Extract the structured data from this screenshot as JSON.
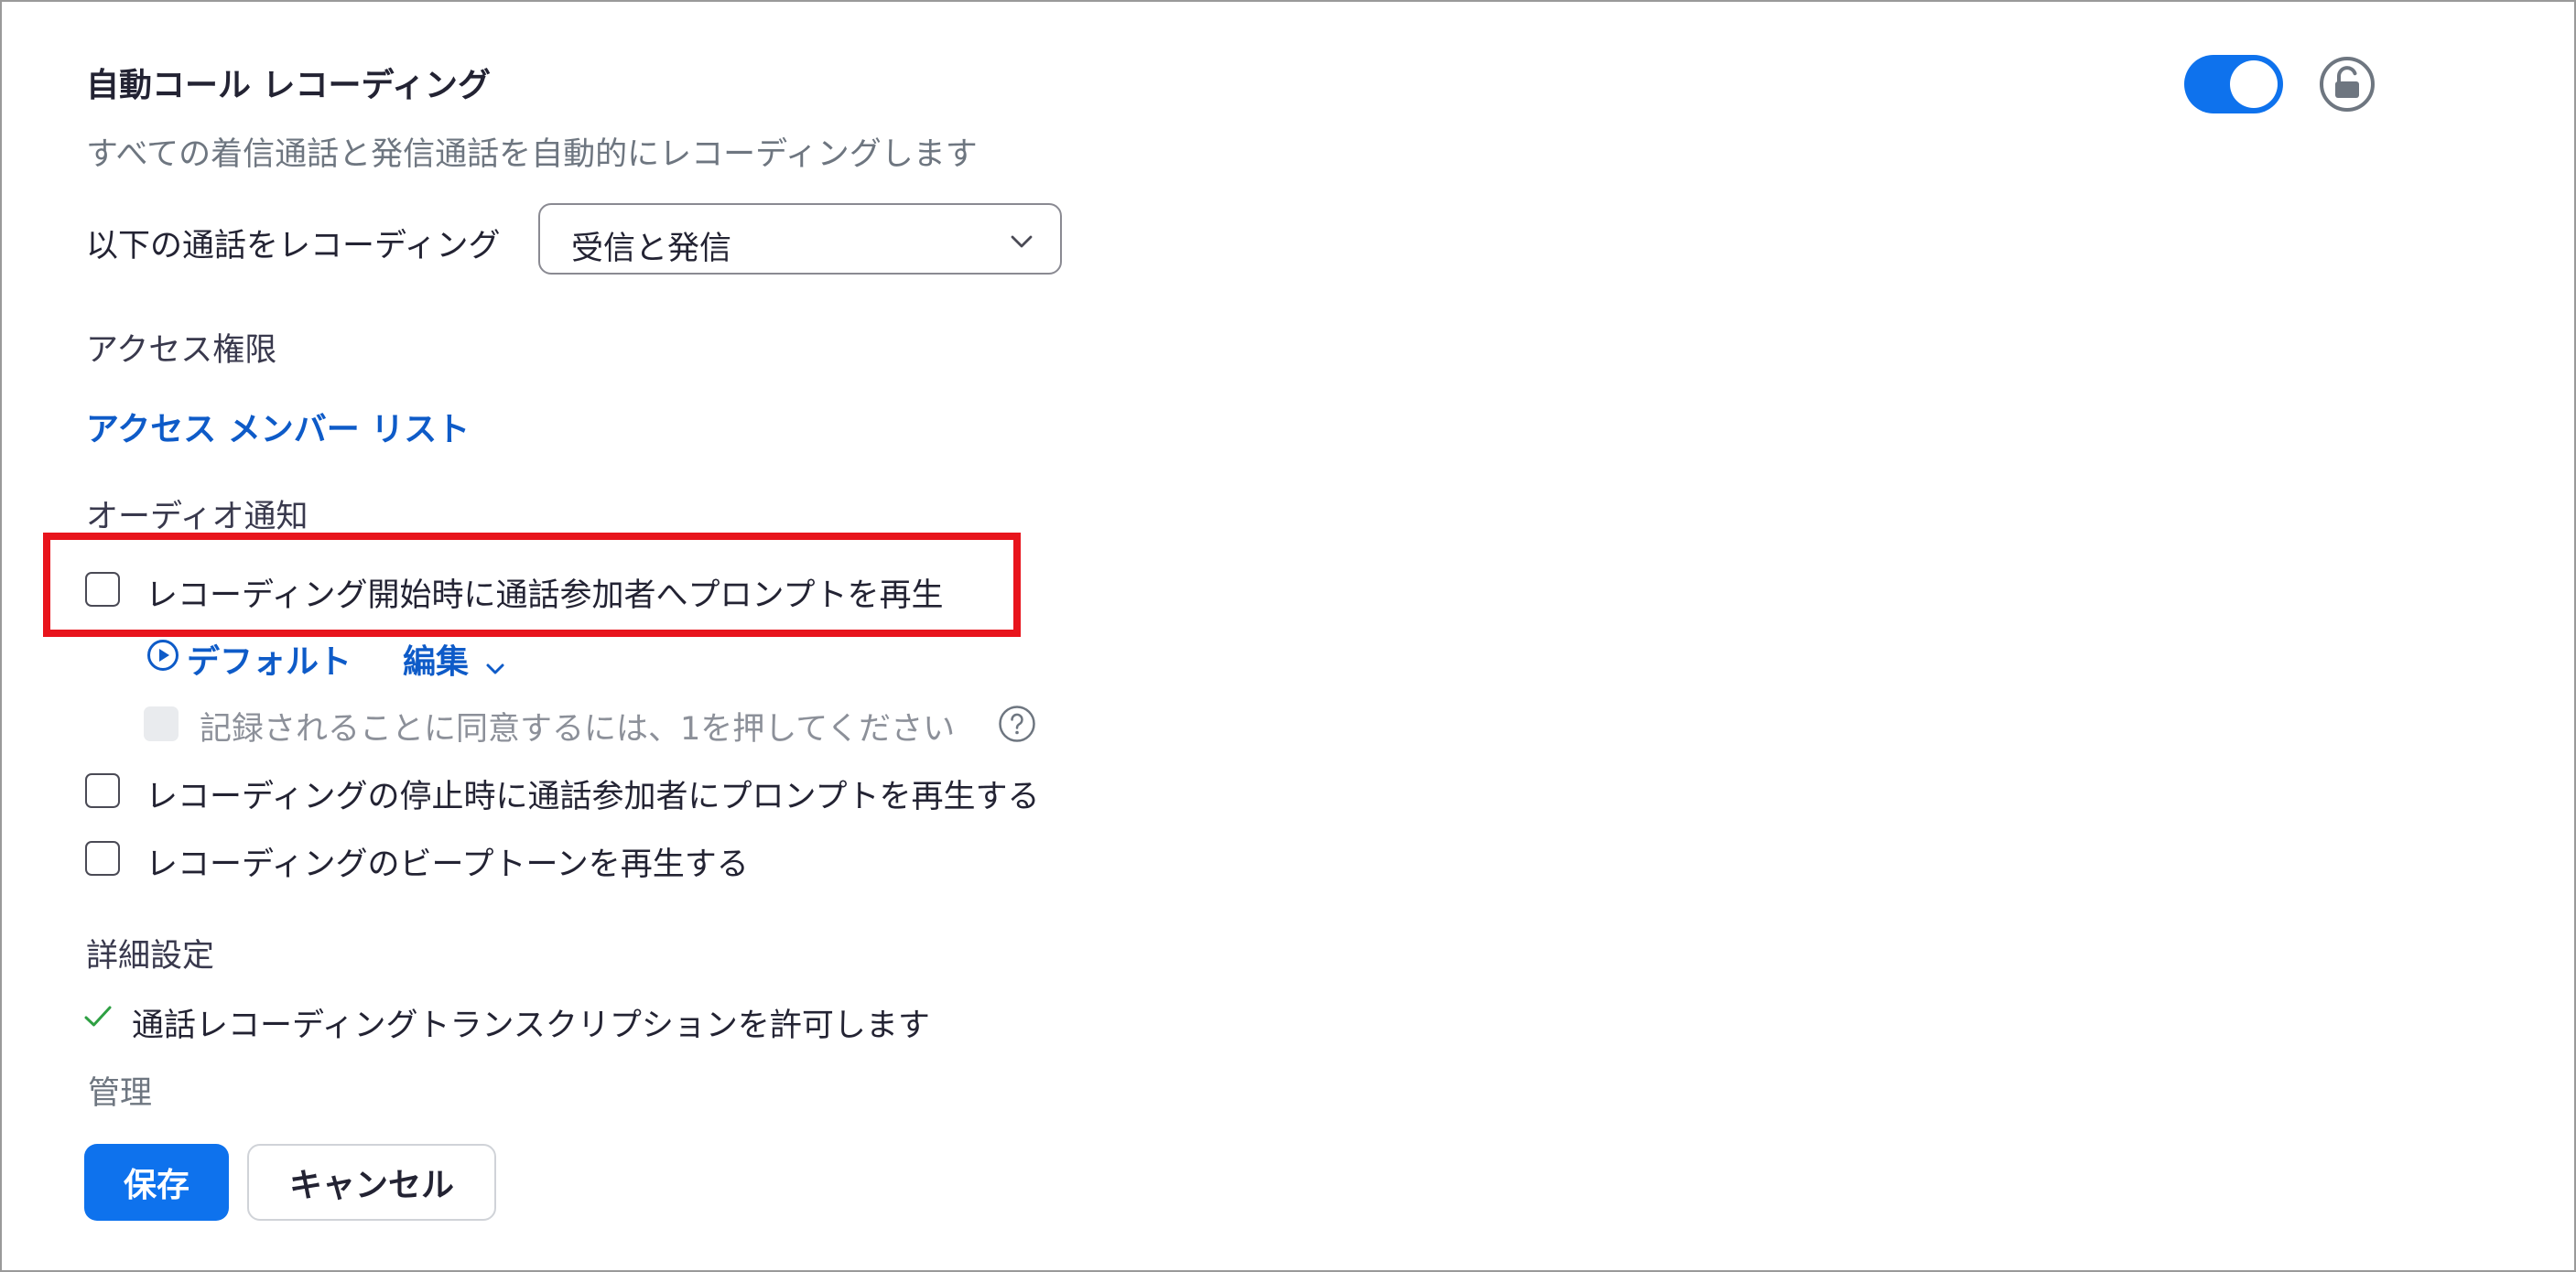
{
  "setting": {
    "title": "自動コール レコーディング",
    "description": "すべての着信通話と発信通話を自動的にレコーディングします",
    "enabled": true
  },
  "record_calls": {
    "label": "以下の通話をレコーディング",
    "selected": "受信と発信"
  },
  "access": {
    "label": "アクセス権限",
    "link": "アクセス メンバー リスト"
  },
  "audio_notification": {
    "label": "オーディオ通知",
    "prompt_start": {
      "label": "レコーディング開始時に通話参加者へプロンプトを再生",
      "checked": false,
      "default_label": "デフォルト",
      "edit_label": "編集",
      "consent": {
        "label": "記録されることに同意するには、1を押してください",
        "checked": false,
        "disabled": true
      }
    },
    "prompt_stop": {
      "label": "レコーディングの停止時に通話参加者にプロンプトを再生する",
      "checked": false
    },
    "beep": {
      "label": "レコーディングのビープトーンを再生する",
      "checked": false
    }
  },
  "advanced": {
    "label": "詳細設定",
    "transcription": "通話レコーディングトランスクリプションを許可します"
  },
  "manage_label": "管理",
  "buttons": {
    "save": "保存",
    "cancel": "キャンセル"
  },
  "colors": {
    "accent": "#0e72ed",
    "link": "#0e5bc8",
    "highlight": "#e8141c",
    "check": "#2ea043"
  },
  "icons": {
    "toggle": "toggle-on",
    "lock": "unlocked-padlock-icon",
    "dropdown": "chevron-down-icon",
    "play": "play-circle-icon",
    "help": "question-circle-icon",
    "check": "checkmark-icon"
  }
}
